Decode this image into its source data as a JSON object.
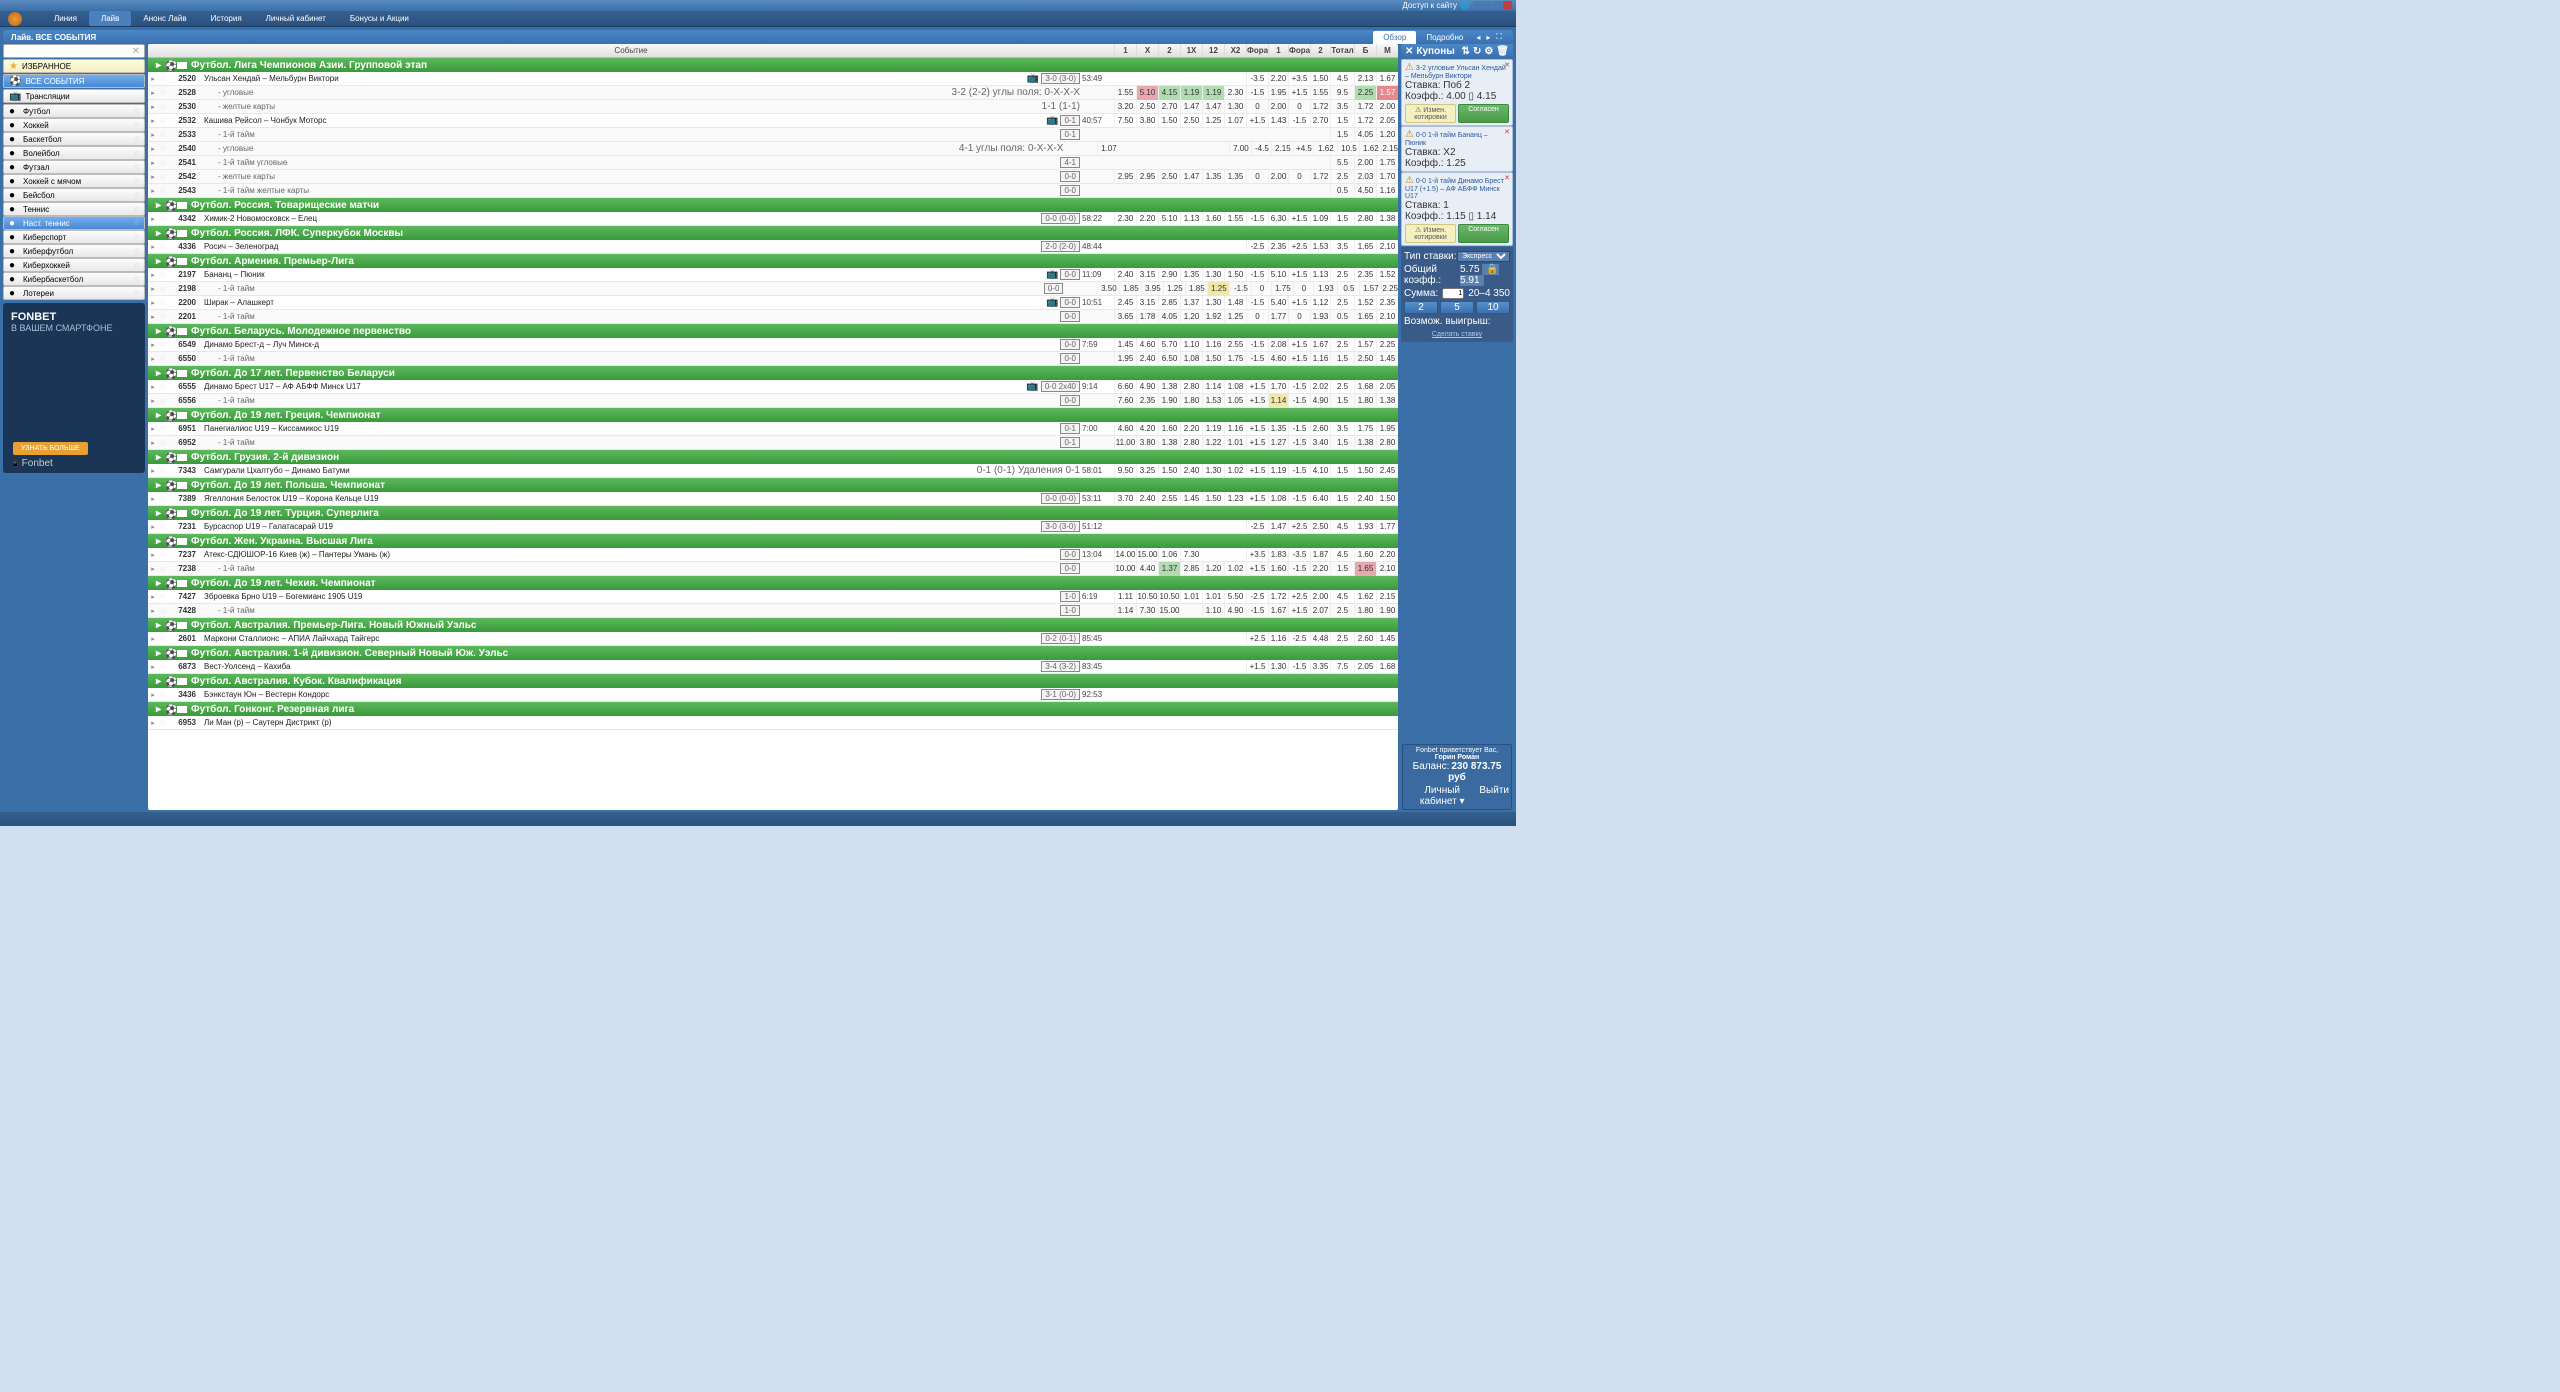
{
  "titlebar": {
    "access": "Доступ к сайту"
  },
  "nav": {
    "items": [
      "Линия",
      "Лайв",
      "Анонс Лайв",
      "История",
      "Личный кабинет",
      "Бонусы и Акции"
    ],
    "active": 1
  },
  "subheader": {
    "title": "Лайв. ВСЕ СОБЫТИЯ",
    "tabs": [
      "Обзор",
      "Подробно"
    ],
    "active": 0
  },
  "sidebar": {
    "fav": "ИЗБРАННОЕ",
    "all": "ВСЕ СОБЫТИЯ",
    "broadcast": "Трансляции",
    "sports": [
      "Футбол",
      "Хоккей",
      "Баскетбол",
      "Волейбол",
      "Футзал",
      "Хоккей с мячом",
      "Бейсбол",
      "Теннис",
      "Наст. теннис",
      "Киберспорт",
      "Киберфутбол",
      "Киберхоккей",
      "Кибербаскетбол",
      "Лотереи"
    ],
    "active_sport": 8
  },
  "promo": {
    "brand": "FONBET",
    "tag": "В ВАШЕМ СМАРТФОНЕ",
    "foot": "Fonbet",
    "btn": "УЗНАТЬ БОЛЬШЕ"
  },
  "columns": {
    "event": "Событие",
    "odds": [
      "1",
      "X",
      "2",
      "1X",
      "12",
      "X2",
      "Фора",
      "1",
      "Фора",
      "2",
      "Тотал",
      "Б",
      "М"
    ]
  },
  "events": [
    {
      "type": "league",
      "flag": "asia",
      "name": "Футбол. Лига Чемпионов Азии. Групповой этап"
    },
    {
      "type": "ev",
      "id": "2520",
      "name": "Ульсан Хендай – Мельбурн Виктори",
      "score": "3-0 (3-0)",
      "time": "53:49",
      "icons": "tv",
      "odds": [
        "",
        "",
        "",
        "",
        "",
        "",
        "-3.5",
        "2.20",
        "+3.5",
        "1.50",
        "4.5",
        "2.13",
        "1.67"
      ]
    },
    {
      "type": "sub",
      "id": "2528",
      "name": "угловые",
      "status": "3-2 (2-2) углы поля: 0-X-X-X",
      "odds": [
        "1.55",
        "5.10",
        "4.15",
        "1.19",
        "1.19",
        "2.30",
        "-1.5",
        "1.95",
        "+1.5",
        "1.55",
        "9.5",
        "2.25",
        "1.57"
      ],
      "hl": {
        "1": "pink",
        "2": "green",
        "3": "green",
        "4": "green",
        "11": "green",
        "12": "red"
      }
    },
    {
      "type": "sub",
      "id": "2530",
      "name": "желтые карты",
      "status": "1-1 (1-1)",
      "odds": [
        "3.20",
        "2.50",
        "2.70",
        "1.47",
        "1.47",
        "1.30",
        "0",
        "2.00",
        "0",
        "1.72",
        "3.5",
        "1.72",
        "2.00"
      ]
    },
    {
      "type": "ev",
      "id": "2532",
      "name": "Кашива Рейсол – Чонбук Моторс",
      "score": "0-1",
      "time": "40:57",
      "icons": "tv",
      "odds": [
        "7.50",
        "3.80",
        "1.50",
        "2.50",
        "1.25",
        "1.07",
        "+1.5",
        "1.43",
        "-1.5",
        "2.70",
        "1.5",
        "1.72",
        "2.05"
      ]
    },
    {
      "type": "sub",
      "id": "2533",
      "name": "1-й тайм",
      "score": "0-1",
      "odds": [
        "",
        "",
        "",
        "",
        "",
        "",
        "",
        "",
        "",
        "",
        "1.5",
        "4.05",
        "1.20"
      ]
    },
    {
      "type": "sub",
      "id": "2540",
      "name": "угловые",
      "status": "4-1 углы поля: 0-X-X-X",
      "odds": [
        "1.07",
        "",
        "",
        "",
        "",
        "",
        "7.00",
        "-4.5",
        "2.15",
        "+4.5",
        "1.62",
        "10.5",
        "1.62",
        "2.15"
      ]
    },
    {
      "type": "sub",
      "id": "2541",
      "name": "1-й тайм угловые",
      "score": "4-1",
      "odds": [
        "",
        "",
        "",
        "",
        "",
        "",
        "",
        "",
        "",
        "",
        "5.5",
        "2.00",
        "1.75"
      ]
    },
    {
      "type": "sub",
      "id": "2542",
      "name": "желтые карты",
      "score": "0-0",
      "odds": [
        "2.95",
        "2.95",
        "2.50",
        "1.47",
        "1.35",
        "1.35",
        "0",
        "2.00",
        "0",
        "1.72",
        "2.5",
        "2.03",
        "1.70"
      ]
    },
    {
      "type": "sub",
      "id": "2543",
      "name": "1-й тайм желтые карты",
      "score": "0-0",
      "odds": [
        "",
        "",
        "",
        "",
        "",
        "",
        "",
        "",
        "",
        "",
        "0.5",
        "4.50",
        "1.16"
      ]
    },
    {
      "type": "league",
      "flag": "ru",
      "name": "Футбол. Россия. Товарищеские матчи"
    },
    {
      "type": "ev",
      "id": "4342",
      "name": "Химик-2 Новомосковск – Елец",
      "score": "0-0 (0-0)",
      "time": "58:22",
      "odds": [
        "2.30",
        "2.20",
        "5.10",
        "1.13",
        "1.60",
        "1.55",
        "-1.5",
        "6.30",
        "+1.5",
        "1.09",
        "1.5",
        "2.80",
        "1.38"
      ]
    },
    {
      "type": "league",
      "flag": "ru",
      "name": "Футбол. Россия. ЛФК. Суперкубок Москвы"
    },
    {
      "type": "ev",
      "id": "4336",
      "name": "Росич – Зеленоград",
      "score": "2-0 (2-0)",
      "time": "48:44",
      "odds": [
        "",
        "",
        "",
        "",
        "",
        "",
        "-2.5",
        "2.35",
        "+2.5",
        "1.53",
        "3.5",
        "1.65",
        "2.10"
      ]
    },
    {
      "type": "league",
      "flag": "am",
      "name": "Футбол. Армения. Премьер-Лига"
    },
    {
      "type": "ev",
      "id": "2197",
      "name": "Бананц – Пюник",
      "score": "0-0",
      "time": "11:09",
      "icons": "tv",
      "odds": [
        "2.40",
        "3.15",
        "2.90",
        "1.35",
        "1.30",
        "1.50",
        "-1.5",
        "5.10",
        "+1.5",
        "1.13",
        "2.5",
        "2.35",
        "1.52"
      ]
    },
    {
      "type": "sub",
      "id": "2198",
      "name": "1-й тайм",
      "score": "0-0",
      "odds": [
        "3.50",
        "1.85",
        "3.95",
        "1.25",
        "1.85",
        "1.25",
        "-1.5",
        "0",
        "1.75",
        "0",
        "1.93",
        "0.5",
        "1.57",
        "2.25"
      ],
      "hl": {
        "5": "yellow"
      }
    },
    {
      "type": "ev",
      "id": "2200",
      "name": "Ширак – Алашкерт",
      "score": "0-0",
      "time": "10:51",
      "icons": "tv",
      "odds": [
        "2.45",
        "3.15",
        "2.85",
        "1.37",
        "1.30",
        "1.48",
        "-1.5",
        "5.40",
        "+1.5",
        "1.12",
        "2.5",
        "1.52",
        "2.35"
      ]
    },
    {
      "type": "sub",
      "id": "2201",
      "name": "1-й тайм",
      "score": "0-0",
      "odds": [
        "3.65",
        "1.78",
        "4.05",
        "1.20",
        "1.92",
        "1.25",
        "0",
        "1.77",
        "0",
        "1.93",
        "0.5",
        "1.65",
        "2.10"
      ]
    },
    {
      "type": "league",
      "flag": "by",
      "name": "Футбол. Беларусь. Молодежное первенство"
    },
    {
      "type": "ev",
      "id": "6549",
      "name": "Динамо Брест-д – Луч Минск-д",
      "score": "0-0",
      "time": "7:59",
      "odds": [
        "1.45",
        "4.60",
        "5.70",
        "1.10",
        "1.16",
        "2.55",
        "-1.5",
        "2.08",
        "+1.5",
        "1.67",
        "2.5",
        "1.57",
        "2.25"
      ]
    },
    {
      "type": "sub",
      "id": "6550",
      "name": "1-й тайм",
      "score": "0-0",
      "odds": [
        "1.95",
        "2.40",
        "6.50",
        "1.08",
        "1.50",
        "1.75",
        "-1.5",
        "4.60",
        "+1.5",
        "1.16",
        "1.5",
        "2.50",
        "1.45"
      ]
    },
    {
      "type": "league",
      "flag": "by",
      "name": "Футбол. До 17 лет. Первенство Беларуси"
    },
    {
      "type": "ev",
      "id": "6555",
      "name": "Динамо Брест U17 – АФ АБФФ Минск U17",
      "score": "0-0 2x40",
      "time": "9:14",
      "icons": "tv",
      "odds": [
        "6.60",
        "4.90",
        "1.38",
        "2.80",
        "1.14",
        "1.08",
        "+1.5",
        "1.70",
        "-1.5",
        "2.02",
        "2.5",
        "1.68",
        "2.05"
      ]
    },
    {
      "type": "sub",
      "id": "6556",
      "name": "1-й тайм",
      "score": "0-0",
      "odds": [
        "7.60",
        "2.35",
        "1.90",
        "1.80",
        "1.53",
        "1.05",
        "+1.5",
        "1.14",
        "-1.5",
        "4.90",
        "1.5",
        "1.80",
        "1.38"
      ],
      "hl": {
        "7": "yellow"
      }
    },
    {
      "type": "league",
      "flag": "gr",
      "name": "Футбол. До 19 лет. Греция. Чемпионат"
    },
    {
      "type": "ev",
      "id": "6951",
      "name": "Панегиалиос U19 – Киссамикос U19",
      "score": "0-1",
      "time": "7:00",
      "odds": [
        "4.60",
        "4.20",
        "1.60",
        "2.20",
        "1.19",
        "1.16",
        "+1.5",
        "1.35",
        "-1.5",
        "2.60",
        "3.5",
        "1.75",
        "1.95"
      ]
    },
    {
      "type": "sub",
      "id": "6952",
      "name": "1-й тайм",
      "score": "0-1",
      "odds": [
        "11.00",
        "3.80",
        "1.38",
        "2.80",
        "1.22",
        "1.01",
        "+1.5",
        "1.27",
        "-1.5",
        "3.40",
        "1.5",
        "1.38",
        "2.80"
      ]
    },
    {
      "type": "league",
      "flag": "ge",
      "name": "Футбол. Грузия. 2-й дивизион"
    },
    {
      "type": "ev",
      "id": "7343",
      "name": "Самгурали Цхалтубо – Динамо Батуми",
      "status": "0-1 (0-1) Удаления 0-1",
      "time": "58:01",
      "odds": [
        "9.50",
        "3.25",
        "1.50",
        "2.40",
        "1.30",
        "1.02",
        "+1.5",
        "1.19",
        "-1.5",
        "4.10",
        "1.5",
        "1.50",
        "2.45"
      ]
    },
    {
      "type": "league",
      "flag": "pl",
      "name": "Футбол. До 19 лет. Польша. Чемпионат"
    },
    {
      "type": "ev",
      "id": "7389",
      "name": "Ягеллония Белосток U19 – Корона Кельце U19",
      "score": "0-0 (0-0)",
      "time": "53:11",
      "odds": [
        "3.70",
        "2.40",
        "2.55",
        "1.45",
        "1.50",
        "1.23",
        "+1.5",
        "1.08",
        "-1.5",
        "6.40",
        "1.5",
        "2.40",
        "1.50"
      ]
    },
    {
      "type": "league",
      "flag": "tr",
      "name": "Футбол. До 19 лет. Турция. Суперлига"
    },
    {
      "type": "ev",
      "id": "7231",
      "name": "Бурсаспор U19 – Галатасарай U19",
      "score": "3-0 (3-0)",
      "time": "51:12",
      "odds": [
        "",
        "",
        "",
        "",
        "",
        "",
        "-2.5",
        "1.47",
        "+2.5",
        "2.50",
        "4.5",
        "1.93",
        "1.77"
      ]
    },
    {
      "type": "league",
      "flag": "ua",
      "name": "Футбол. Жен. Украина. Высшая Лига"
    },
    {
      "type": "ev",
      "id": "7237",
      "name": "Атекс-СДЮШОР-16 Киев (ж) – Пантеры Умань (ж)",
      "score": "0-0",
      "time": "13:04",
      "odds": [
        "14.00",
        "15.00",
        "1.06",
        "7.30",
        "",
        "",
        "+3.5",
        "1.83",
        "-3.5",
        "1.87",
        "4.5",
        "1.60",
        "2.20"
      ]
    },
    {
      "type": "sub",
      "id": "7238",
      "name": "1-й тайм",
      "score": "0-0",
      "odds": [
        "10.00",
        "4.40",
        "1.37",
        "2.85",
        "1.20",
        "1.02",
        "+1.5",
        "1.60",
        "-1.5",
        "2.20",
        "1.5",
        "1.65",
        "2.10"
      ],
      "hl": {
        "2": "green",
        "11": "pink"
      }
    },
    {
      "type": "league",
      "flag": "cz",
      "name": "Футбол. До 19 лет. Чехия. Чемпионат"
    },
    {
      "type": "ev",
      "id": "7427",
      "name": "Зброевка Брно U19 – Богемианс 1905 U19",
      "score": "1-0",
      "time": "6:19",
      "odds": [
        "1.11",
        "10.50",
        "10.50",
        "1.01",
        "1.01",
        "5.50",
        "-2.5",
        "1.72",
        "+2.5",
        "2.00",
        "4.5",
        "1.62",
        "2.15"
      ]
    },
    {
      "type": "sub",
      "id": "7428",
      "name": "1-й тайм",
      "score": "1-0",
      "odds": [
        "1.14",
        "7.30",
        "15.00",
        "",
        "1.10",
        "4.90",
        "-1.5",
        "1.67",
        "+1.5",
        "2.07",
        "2.5",
        "1.80",
        "1.90"
      ]
    },
    {
      "type": "league",
      "flag": "au",
      "name": "Футбол. Австралия. Премьер-Лига. Новый Южный Уэльс"
    },
    {
      "type": "ev",
      "id": "2601",
      "name": "Маркони Сталлионс – АПИА Лайчхард Тайгерс",
      "score": "0-2 (0-1)",
      "time": "85:45",
      "odds": [
        "",
        "",
        "",
        "",
        "",
        "",
        "+2.5",
        "1.16",
        "-2.5",
        "4.48",
        "2.5",
        "2.60",
        "1.45"
      ]
    },
    {
      "type": "league",
      "flag": "au",
      "name": "Футбол. Австралия. 1-й дивизион. Северный Новый Юж. Уэльс"
    },
    {
      "type": "ev",
      "id": "6873",
      "name": "Вест-Уолсенд – Кахиба",
      "score": "3-4 (3-2)",
      "time": "83:45",
      "odds": [
        "",
        "",
        "",
        "",
        "",
        "",
        "+1.5",
        "1.30",
        "-1.5",
        "3.35",
        "7.5",
        "2.05",
        "1.68"
      ]
    },
    {
      "type": "league",
      "flag": "au",
      "name": "Футбол. Австралия. Кубок. Квалификация"
    },
    {
      "type": "ev",
      "id": "3436",
      "name": "Бэнкстаун Юн – Вестерн Кондорс",
      "score": "3-1 (0-0)",
      "time": "92:53",
      "odds": [
        "",
        "",
        "",
        "",
        "",
        "",
        "",
        "",
        "",
        "",
        "",
        "",
        ""
      ]
    },
    {
      "type": "league",
      "flag": "hk",
      "name": "Футбол. Гонконг. Резервная лига"
    },
    {
      "type": "ev",
      "id": "6953",
      "name": "Ли Ман (р) – Саутерн Дистрикт (р)",
      "score": "",
      "time": "",
      "odds": [
        "",
        "",
        "",
        "",
        "",
        "",
        "",
        "",
        "",
        "",
        "",
        "",
        ""
      ]
    }
  ],
  "coupon": {
    "title": "Купоны",
    "bets": [
      {
        "title": "3-2 угловые Ульсан Хендай – Мельбурн Виктори",
        "line": "Ставка: Поб 2",
        "odds": "Коэфф.: 4.00 ▯ 4.15",
        "warn": "Измен. котировки",
        "ok": "Согласен"
      },
      {
        "title": "0-0 1-й тайм Бананц – Пюник",
        "line": "Ставка: X2",
        "odds": "Коэфф.: 1.25",
        "warn": "",
        "ok": ""
      },
      {
        "title": "0-0 1-й тайм Динамо Брест U17 (+1.5) – АФ АБФФ Минск U17",
        "line": "Ставка: 1",
        "odds": "Коэфф.: 1.15 ▯ 1.14",
        "warn": "Измен. котировки",
        "ok": "Согласен"
      }
    ],
    "summary": {
      "type_lbl": "Тип ставки:",
      "type_val": "Экспресс",
      "total_lbl": "Общий коэфф.:",
      "total_val": "5.75",
      "total_lock": "5.91",
      "sum_lbl": "Сумма:",
      "sum_val": "1",
      "range": "20–4 350",
      "tbtns": [
        "2",
        "5",
        "10"
      ],
      "win_lbl": "Возмож. выигрыш:",
      "do": "Сделать ставку"
    }
  },
  "welcome": {
    "hello": "Fonbet приветствует Вас,",
    "name": "Горин Роман",
    "balance_lbl": "Баланс:",
    "balance": "230 873.75 руб"
  },
  "footer": {
    "cabinet": "Личный кабинет ▾",
    "logout": "Выйти"
  }
}
